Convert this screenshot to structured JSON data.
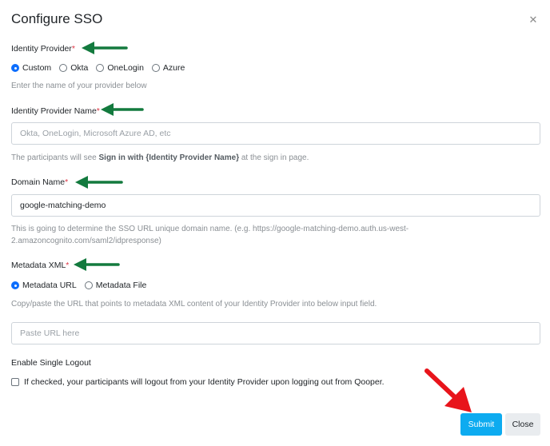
{
  "dialog": {
    "title": "Configure SSO",
    "close_icon": "close-icon"
  },
  "identity_provider": {
    "label": "Identity Provider",
    "required_mark": "*",
    "options": [
      {
        "label": "Custom",
        "selected": true
      },
      {
        "label": "Okta",
        "selected": false
      },
      {
        "label": "OneLogin",
        "selected": false
      },
      {
        "label": "Azure",
        "selected": false
      }
    ],
    "hint": "Enter the name of your provider below"
  },
  "identity_provider_name": {
    "label": "Identity Provider Name",
    "required_mark": "*",
    "placeholder": "Okta, OneLogin, Microsoft Azure AD, etc",
    "value": "",
    "hint_prefix": "The participants will see ",
    "hint_bold": "Sign in with {Identity Provider Name}",
    "hint_suffix": " at the sign in page."
  },
  "domain_name": {
    "label": "Domain Name",
    "required_mark": "*",
    "value": "google-matching-demo",
    "hint_line1": "This is going to determine the SSO URL unique domain name. (e.g. https://google-matching-demo.auth.us-west-",
    "hint_line2": "2.amazoncognito.com/saml2/idpresponse)"
  },
  "metadata_xml": {
    "label": "Metadata XML",
    "required_mark": "*",
    "options": [
      {
        "label": "Metadata URL",
        "selected": true
      },
      {
        "label": "Metadata File",
        "selected": false
      }
    ],
    "hint": "Copy/paste the URL that points to metadata XML content of your Identity Provider into below input field.",
    "placeholder": "Paste URL here",
    "value": ""
  },
  "single_logout": {
    "label": "Enable Single Logout",
    "checkbox_label": "If checked, your participants will logout from your Identity Provider upon logging out from Qooper.",
    "checked": false
  },
  "footer": {
    "submit_label": "Submit",
    "close_label": "Close"
  },
  "colors": {
    "primary_button": "#0dabf0",
    "annotation_arrow_green": "#137a3e",
    "annotation_arrow_red": "#e8141b",
    "required": "#dc3545"
  }
}
